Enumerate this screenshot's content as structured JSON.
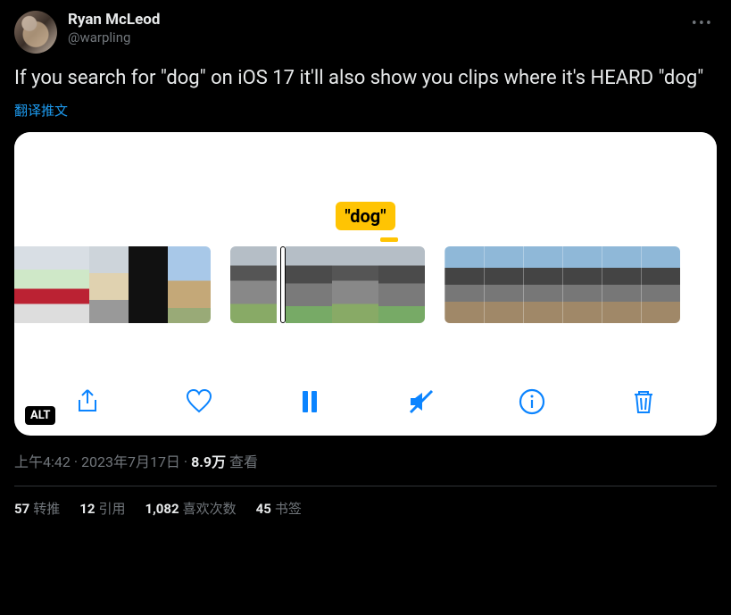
{
  "author": {
    "display_name": "Ryan McLeod",
    "handle": "@warpling"
  },
  "tweet_text": "If you search for \"dog\" on iOS 17 it'll also show you clips where it's HEARD \"dog\"",
  "translate_label": "翻译推文",
  "media": {
    "search_label": "\"dog\"",
    "alt_badge": "ALT",
    "toolbar": {
      "share": "share-icon",
      "like": "heart-icon",
      "pause": "pause-icon",
      "mute": "mute-icon",
      "info": "info-icon",
      "delete": "trash-icon"
    }
  },
  "meta": {
    "time": "上午4:42",
    "date": "2023年7月17日",
    "views_count": "8.9万",
    "views_label": "查看",
    "sep": " · "
  },
  "stats": {
    "retweets_count": "57",
    "retweets_label": "转推",
    "quotes_count": "12",
    "quotes_label": "引用",
    "likes_count": "1,082",
    "likes_label": "喜欢次数",
    "bookmarks_count": "45",
    "bookmarks_label": "书签"
  },
  "more_label": "•••"
}
